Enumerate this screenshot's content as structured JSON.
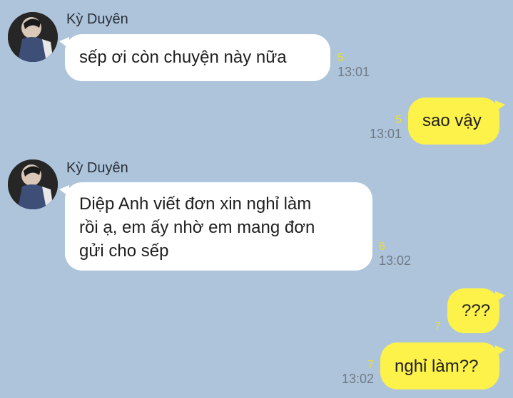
{
  "contact": {
    "name": "Kỳ Duyên"
  },
  "messages": [
    {
      "direction": "in",
      "text": "sếp ơi còn chuyện này nữa",
      "read": "5",
      "time": "13:01"
    },
    {
      "direction": "out",
      "text": "sao vậy",
      "read": "5",
      "time": "13:01"
    },
    {
      "direction": "in",
      "lines": [
        "Diệp Anh viết đơn xin nghỉ làm",
        "rồi ạ, em ấy nhờ em mang đơn",
        "gửi cho sếp"
      ],
      "read": "6",
      "time": "13:02"
    },
    {
      "direction": "out",
      "text": "???",
      "read": "7",
      "time": ""
    },
    {
      "direction": "out",
      "text": "nghỉ làm??",
      "read": "7",
      "time": "13:02"
    }
  ],
  "colors": {
    "background": "#aec4db",
    "incoming_bubble": "#ffffff",
    "outgoing_bubble": "#fdf24a",
    "read_count": "#e9dd3a"
  }
}
